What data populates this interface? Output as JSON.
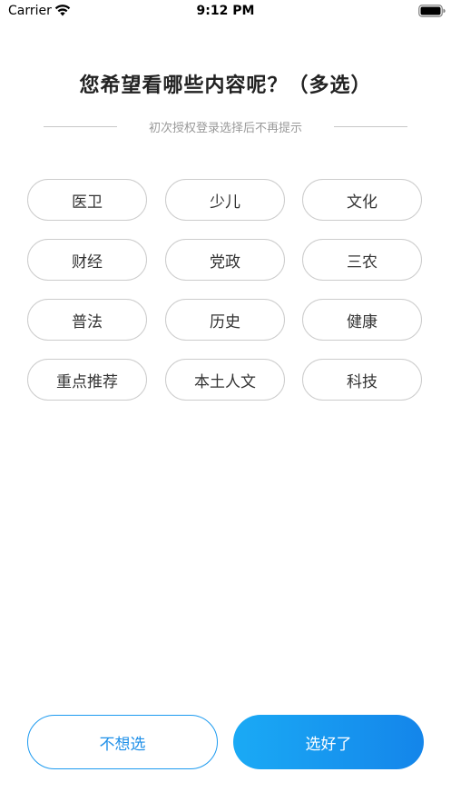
{
  "status_bar": {
    "carrier": "Carrier",
    "time": "9:12 PM"
  },
  "title": "您希望看哪些内容呢？（多选）",
  "subtitle": "初次授权登录选择后不再提示",
  "tags": [
    "医卫",
    "少儿",
    "文化",
    "财经",
    "党政",
    "三农",
    "普法",
    "历史",
    "健康",
    "重点推荐",
    "本土人文",
    "科技"
  ],
  "buttons": {
    "skip_label": "不想选",
    "done_label": "选好了"
  },
  "colors": {
    "accent": "#1E9BF0",
    "tag_border": "#cccccc",
    "subtitle": "#999999"
  }
}
